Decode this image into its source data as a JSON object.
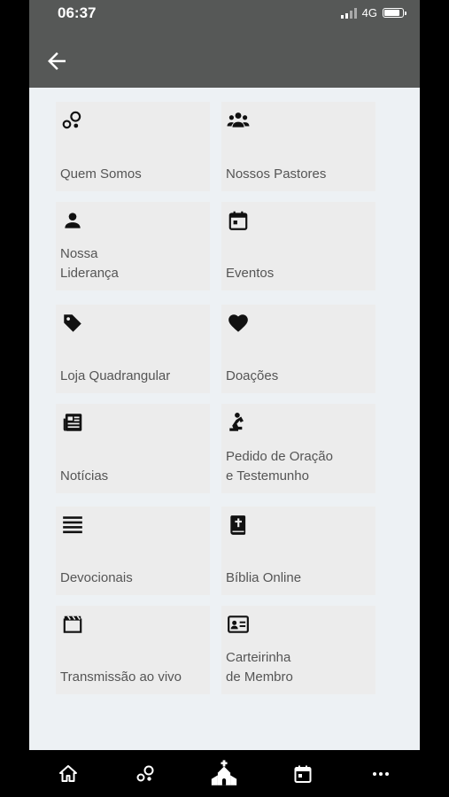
{
  "status": {
    "time": "06:37",
    "network": "4G",
    "battery_level": 0.9
  },
  "tiles": [
    {
      "label": "Quem Somos",
      "icon": "bubbles-icon"
    },
    {
      "label": "Nossos Pastores",
      "icon": "group-icon"
    },
    {
      "label": "Nossa\nLiderança",
      "icon": "person-icon"
    },
    {
      "label": "Eventos",
      "icon": "calendar-icon"
    },
    {
      "label": "Loja Quadrangular",
      "icon": "tag-icon"
    },
    {
      "label": "Doações",
      "icon": "heart-icon"
    },
    {
      "label": "Notícias",
      "icon": "newspaper-icon"
    },
    {
      "label": "Pedido de Oração\ne Testemunho",
      "icon": "praying-icon"
    },
    {
      "label": "Devocionais",
      "icon": "list-lines-icon"
    },
    {
      "label": "Bíblia Online",
      "icon": "bible-icon"
    },
    {
      "label": "Transmissão ao vivo",
      "icon": "clapperboard-icon"
    },
    {
      "label": "Carteirinha\nde Membro",
      "icon": "id-card-icon"
    }
  ],
  "bottom_nav": [
    {
      "icon": "home-icon"
    },
    {
      "icon": "bubbles-icon"
    },
    {
      "icon": "church-icon"
    },
    {
      "icon": "calendar-icon"
    },
    {
      "icon": "more-icon"
    }
  ]
}
